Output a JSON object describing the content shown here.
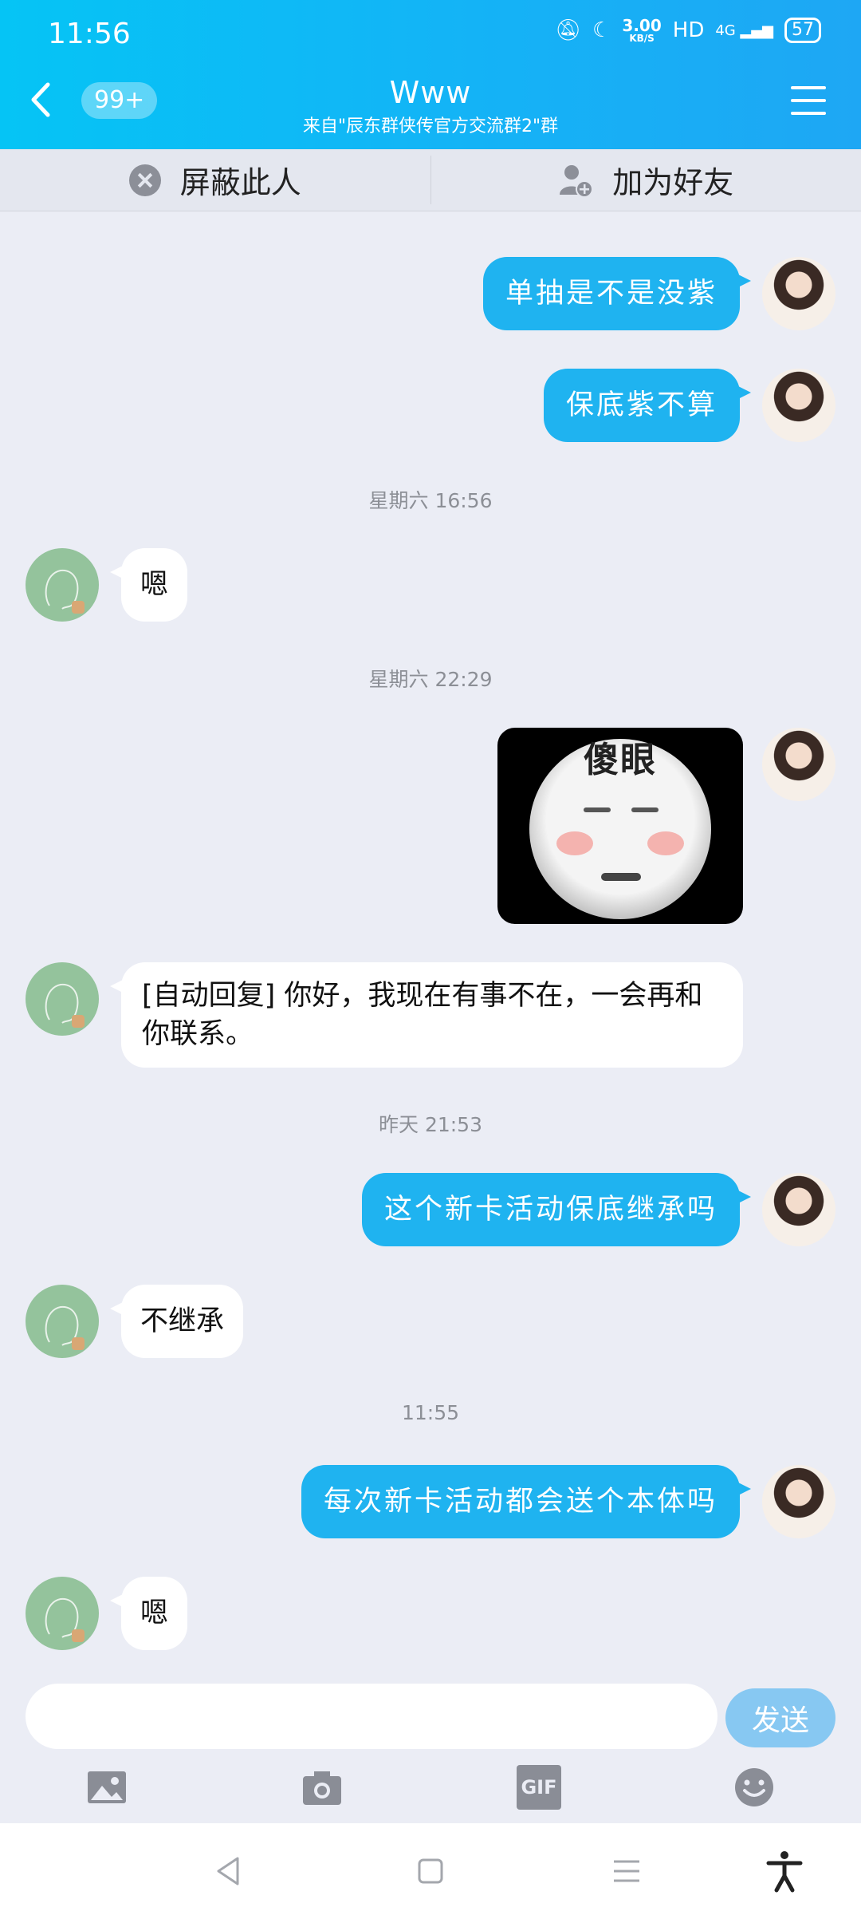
{
  "status_bar": {
    "time": "11:56",
    "speed_value": "3.00",
    "speed_unit": "KB/S",
    "hd": "HD",
    "network": "4G",
    "battery": "57"
  },
  "header": {
    "unread_badge": "99+",
    "title": "Www",
    "subtitle": "来自\"辰东群侠传官方交流群2\"群"
  },
  "action_bar": {
    "block_label": "屏蔽此人",
    "add_friend_label": "加为好友"
  },
  "messages": {
    "m1": "单抽是不是没紫",
    "m2": "保底紫不算",
    "ts1": "星期六 16:56",
    "m3": "嗯",
    "ts2": "星期六 22:29",
    "sticker_caption": "傻眼",
    "m4": "[自动回复] 你好，我现在有事不在，一会再和你联系。",
    "ts3": "昨天 21:53",
    "m5": "这个新卡活动保底继承吗",
    "m6": "不继承",
    "ts4": "11:55",
    "m7": "每次新卡活动都会送个本体吗",
    "m8": "嗯"
  },
  "input": {
    "value": "",
    "send_label": "发送"
  },
  "tools": {
    "gif_label": "GIF"
  },
  "icons": {
    "back": "chevron-left-icon",
    "menu": "hamburger-icon",
    "block": "block-icon",
    "add_friend": "add-friend-icon",
    "image": "image-icon",
    "camera": "camera-icon",
    "gif": "gif-icon",
    "emoji": "emoji-icon"
  },
  "colors": {
    "header_start": "#05c4f5",
    "header_end": "#1ea7f4",
    "my_bubble": "#1fb3f0",
    "peer_bubble": "#ffffff",
    "send_button": "#87c8f2",
    "background": "#ebedf5"
  }
}
